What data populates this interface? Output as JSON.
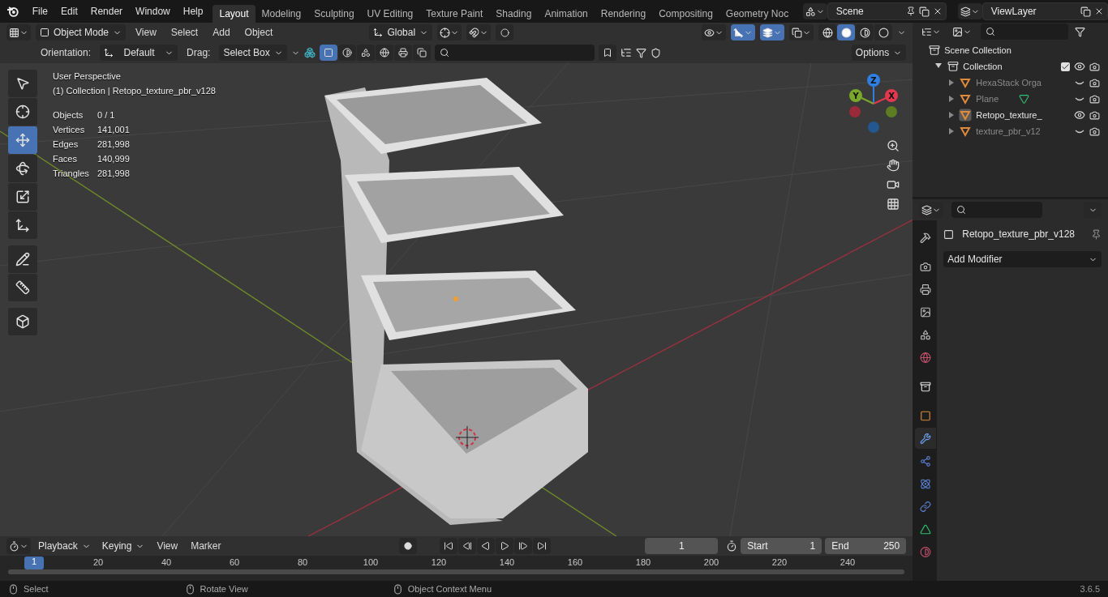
{
  "menu": [
    "File",
    "Edit",
    "Render",
    "Window",
    "Help"
  ],
  "workspaces": [
    {
      "label": "Layout",
      "selected": true
    },
    {
      "label": "Modeling",
      "selected": false
    },
    {
      "label": "Sculpting",
      "selected": false
    },
    {
      "label": "UV Editing",
      "selected": false
    },
    {
      "label": "Texture Paint",
      "selected": false
    },
    {
      "label": "Shading",
      "selected": false
    },
    {
      "label": "Animation",
      "selected": false
    },
    {
      "label": "Rendering",
      "selected": false
    },
    {
      "label": "Compositing",
      "selected": false
    },
    {
      "label": "Geometry Noc",
      "selected": false
    }
  ],
  "scene": {
    "name": "Scene"
  },
  "view_layer": {
    "name": "ViewLayer"
  },
  "viewport_header": {
    "mode": "Object Mode",
    "menus": [
      "View",
      "Select",
      "Add",
      "Object"
    ],
    "orientation": "Global",
    "toggles": [
      {
        "kind": "visibility",
        "on": false
      },
      {
        "kind": "gizmo",
        "on": true
      },
      {
        "kind": "overlay",
        "on": true
      },
      {
        "kind": "xray",
        "on": false
      }
    ],
    "shading": [
      {
        "kind": "wireframe",
        "selected": false
      },
      {
        "kind": "solid",
        "selected": true
      },
      {
        "kind": "material",
        "selected": false
      },
      {
        "kind": "rendered",
        "selected": false
      }
    ]
  },
  "tool_settings": {
    "orientation_label": "Orientation:",
    "orientation": "Default",
    "drag_label": "Drag:",
    "drag": "Select Box",
    "options": "Options"
  },
  "tools": [
    {
      "kind": "select",
      "selected": false
    },
    {
      "kind": "cursor",
      "selected": false
    },
    {
      "kind": "move",
      "selected": true
    },
    {
      "kind": "rotate",
      "selected": false
    },
    {
      "kind": "scale",
      "selected": false
    },
    {
      "kind": "transform",
      "selected": false
    },
    {
      "kind": "annotate",
      "selected": false
    },
    {
      "kind": "measure",
      "selected": false
    },
    {
      "kind": "add-cube",
      "selected": false
    }
  ],
  "overlay": {
    "view": "User Perspective",
    "collection": "(1) Collection | Retopo_texture_pbr_v128",
    "stats": [
      {
        "label": "Objects",
        "value": "0 / 1"
      },
      {
        "label": "Vertices",
        "value": "141,001"
      },
      {
        "label": "Edges",
        "value": "281,998"
      },
      {
        "label": "Faces",
        "value": "140,999"
      },
      {
        "label": "Triangles",
        "value": "281,998"
      }
    ]
  },
  "gizmo": [
    {
      "label": "Z",
      "color": "#2f7fe0"
    },
    {
      "label": "X",
      "color": "#e0394f"
    },
    {
      "label": "Y",
      "color": "#7aa82a"
    }
  ],
  "outliner": {
    "root": "Scene Collection",
    "collections": [
      {
        "name": "Collection",
        "expanded": true,
        "checked": true,
        "visible": true,
        "children": [
          {
            "name": "HexaStack Orga",
            "selected": false,
            "visible": false,
            "mesh_data": false
          },
          {
            "name": "Plane",
            "selected": false,
            "visible": false,
            "mesh_data": true
          },
          {
            "name": "Retopo_texture_",
            "selected": true,
            "visible": true,
            "mesh_data": false
          },
          {
            "name": "texture_pbr_v12",
            "selected": false,
            "visible": false,
            "mesh_data": false
          }
        ]
      }
    ]
  },
  "properties": {
    "object": "Retopo_texture_pbr_v128",
    "add_modifier": "Add Modifier",
    "tabs": [
      {
        "kind": "tool",
        "selected": false
      },
      {
        "kind": "render",
        "selected": false
      },
      {
        "kind": "output",
        "selected": false
      },
      {
        "kind": "view_layer",
        "selected": false
      },
      {
        "kind": "scene",
        "selected": false
      },
      {
        "kind": "world",
        "selected": false
      },
      {
        "kind": "collection",
        "selected": false
      },
      {
        "kind": "object",
        "selected": false
      },
      {
        "kind": "modifiers",
        "selected": true
      },
      {
        "kind": "particles",
        "selected": false
      },
      {
        "kind": "physics",
        "selected": false
      },
      {
        "kind": "constraints",
        "selected": false
      },
      {
        "kind": "data",
        "selected": false
      },
      {
        "kind": "material",
        "selected": false
      }
    ]
  },
  "timeline": {
    "menus": [
      "Playback",
      "Keying",
      "View",
      "Marker"
    ],
    "current_frame": "1",
    "start_label": "Start",
    "start": "1",
    "end_label": "End",
    "end": "250",
    "ruler_current": "1",
    "ruler_ticks": [
      "20",
      "40",
      "60",
      "80",
      "100",
      "120",
      "140",
      "160",
      "180",
      "200",
      "220",
      "240"
    ]
  },
  "status_bar": {
    "hints": [
      "Select",
      "Rotate View",
      "Object Context Menu"
    ],
    "version": "3.6.5"
  }
}
